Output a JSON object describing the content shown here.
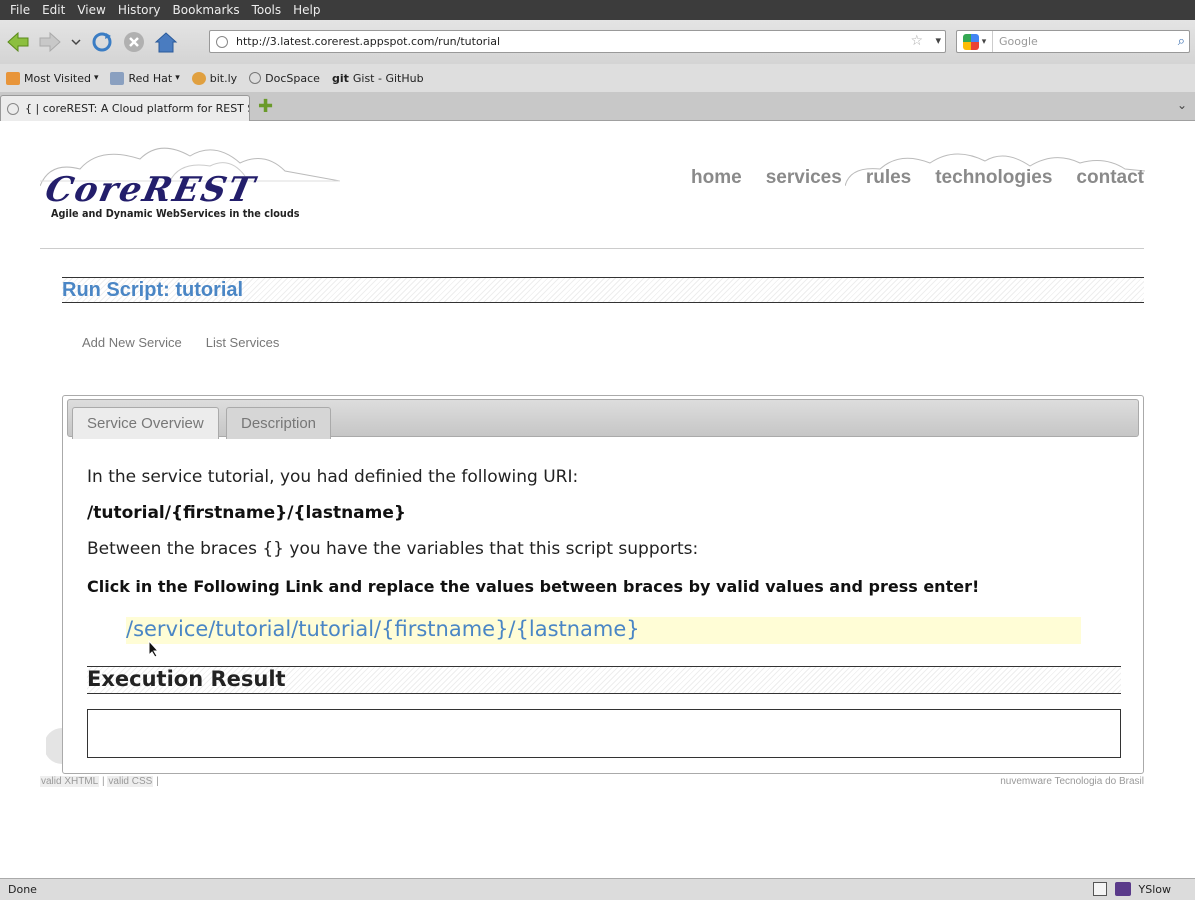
{
  "browser": {
    "menu": [
      "File",
      "Edit",
      "View",
      "History",
      "Bookmarks",
      "Tools",
      "Help"
    ],
    "url": "http://3.latest.corerest.appspot.com/run/tutorial",
    "search_placeholder": "Google",
    "bookmarks": [
      {
        "label": "Most Visited",
        "icon": "rss-icon"
      },
      {
        "label": "Red Hat",
        "icon": "folder-icon"
      },
      {
        "label": "bit.ly",
        "icon": "bitly-icon"
      },
      {
        "label": "DocSpace",
        "icon": "globe-icon"
      },
      {
        "label": "Gist - GitHub",
        "icon": "git-icon",
        "prefix": "git"
      }
    ],
    "tab_title": "{ | coreREST: A Cloud platform for REST Se...",
    "status": "Done",
    "status_right": "YSlow"
  },
  "site": {
    "logo": "CoreREST",
    "tagline": "Agile and Dynamic WebServices in the clouds",
    "nav": [
      "home",
      "services",
      "rules",
      "technologies",
      "contact"
    ],
    "page_title": "Run Script: tutorial",
    "sublinks": [
      "Add New Service",
      "List Services"
    ],
    "tabs": [
      "Service Overview",
      "Description"
    ],
    "intro": "In the service tutorial, you had definied the following URI:",
    "uri": "/tutorial/{firstname}/{lastname}",
    "braces_text": "Between the braces {} you have the variables that this script supports:",
    "instruction": "Click in the Following Link and replace the values between braces by valid values and press enter!",
    "service_link": "/service/tutorial/tutorial/{firstname}/{lastname}",
    "execution_title": "Execution Result",
    "footer_left": {
      "xhtml": "valid XHTML",
      "sep1": "|",
      "css": "valid CSS",
      "sep2": "|"
    },
    "footer_right": "nuvemware Tecnologia do Brasil"
  },
  "colors": {
    "link": "#4a86c5",
    "logo": "#231e6b",
    "highlight": "#fffdd6"
  }
}
